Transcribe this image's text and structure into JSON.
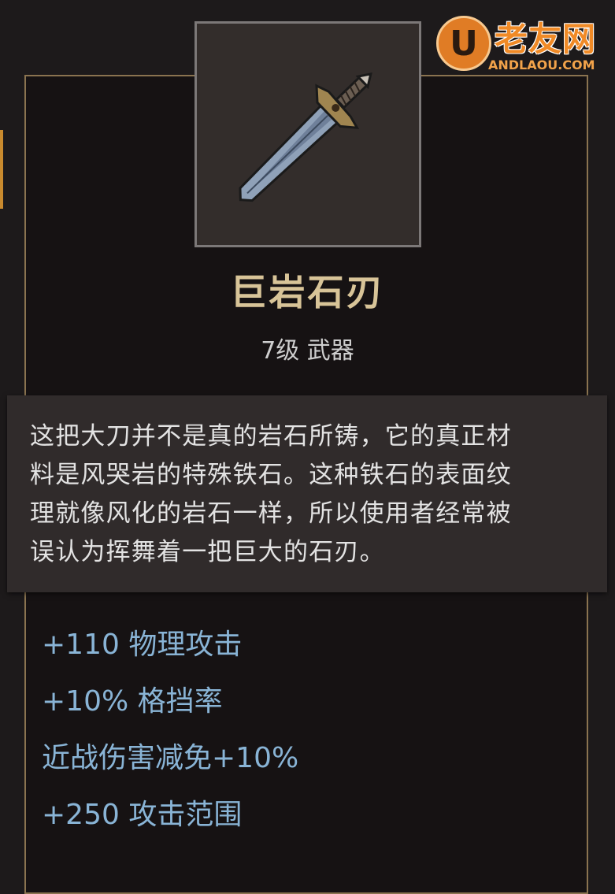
{
  "watermark": {
    "glyph": "U",
    "name": "老友网",
    "url": "ANDLAOU.COM",
    "color": "#f08a26"
  },
  "item": {
    "icon": "sword-icon",
    "name": "巨岩石刃",
    "meta": "7级 武器",
    "description_lines": [
      "这把大刀并不是真的岩石所铸，它的真正材",
      "料是风哭岩的特殊铁石。这种铁石的表面纹",
      "理就像风化的岩石一样，所以使用者经常被",
      "误认为挥舞着一把巨大的石刃。"
    ],
    "stats": [
      "+110 物理攻击",
      "+10% 格挡率",
      "近战伤害减免+10%",
      "+250 攻击范围"
    ]
  },
  "colors": {
    "name": "#d8c498",
    "stat": "#89b4d6",
    "border": "#8a7350",
    "accent": "#c98a2e"
  }
}
